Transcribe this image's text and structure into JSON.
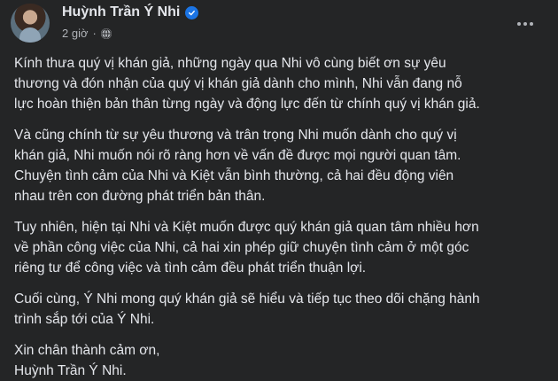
{
  "post": {
    "author": "Huỳnh Trần Ý Nhi",
    "time": "2 giờ",
    "separator": "·",
    "privacy_icon": "globe-icon",
    "verified_icon": "verified-badge-icon",
    "more_icon": "more-options-icon",
    "paragraphs": [
      [
        "Kính thưa quý vị khán giả, những ngày qua Nhi vô cùng biết ơn sự yêu",
        "thương và đón nhận của quý vị khán giả dành cho mình, Nhi vẫn đang nỗ",
        "lực hoàn thiện bản thân từng ngày và động lực đến từ chính quý vị khán giả."
      ],
      [
        "Và cũng chính từ sự yêu thương và trân trọng Nhi muốn dành cho quý vị",
        "khán giả, Nhi muốn nói rõ ràng hơn về vấn đề được mọi người quan tâm.",
        "Chuyện tình cảm của Nhi và Kiệt vẫn bình thường, cả hai đều động viên",
        "nhau trên con đường phát triển bản thân."
      ],
      [
        "Tuy nhiên, hiện tại Nhi và Kiệt muốn được quý khán giả quan tâm nhiều hơn",
        "về phần công việc của Nhi, cả hai xin phép giữ chuyện tình cảm ở một góc",
        "riêng tư để công việc và tình cảm đều phát triển thuận lợi."
      ],
      [
        "Cuối cùng, Ý Nhi mong quý khán giả sẽ hiểu và tiếp tục theo dõi chặng hành",
        "trình sắp tới của Ý Nhi."
      ],
      [
        "Xin chân thành cảm ơn,",
        "Huỳnh Trần Ý Nhi."
      ]
    ]
  },
  "colors": {
    "background": "#242526",
    "text_primary": "#e4e6eb",
    "text_secondary": "#b0b3b8",
    "verified_blue": "#1b74e4"
  }
}
